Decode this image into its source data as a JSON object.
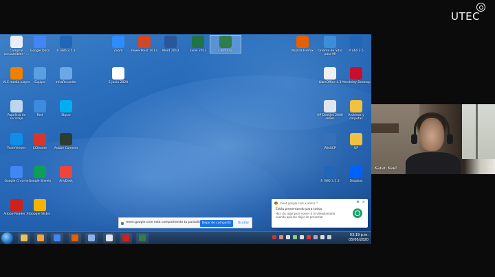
{
  "branding": {
    "logo_text": "UTEC"
  },
  "participant": {
    "name": "Karen Keel"
  },
  "desktop_icons": [
    {
      "label": "Comprar consumibles - ...",
      "icon": "printer-icon",
      "color": "#e9eef5"
    },
    {
      "label": "Google Docs",
      "icon": "docs-icon",
      "color": "#4285f4"
    },
    {
      "label": "R i386 3.5.3",
      "icon": "r-icon",
      "color": "#2266b8"
    },
    {
      "label": "Zoom",
      "icon": "zoom-icon",
      "color": "#2d8cff"
    },
    {
      "label": "PowerPoint 2013",
      "icon": "powerpoint-icon",
      "color": "#d24726"
    },
    {
      "label": "Word 2013",
      "icon": "word-icon",
      "color": "#2b579a"
    },
    {
      "label": "Excel 2013",
      "icon": "excel-icon",
      "color": "#217346"
    },
    {
      "label": "Camtasia",
      "icon": "camtasia-icon",
      "color": "#2f7d4a"
    },
    {
      "label": "Mozilla Firefox",
      "icon": "firefox-icon",
      "color": "#e66000"
    },
    {
      "label": "Oriente de Sitio para Mí",
      "icon": "box-icon",
      "color": "#3a8fd8"
    },
    {
      "label": "R x64 3.5",
      "icon": "r-icon",
      "color": "#2266b8"
    },
    {
      "label": "VLC media player",
      "icon": "vlc-icon",
      "color": "#f08000"
    },
    {
      "label": "Equipo",
      "icon": "computer-icon",
      "color": "#5aa0e0"
    },
    {
      "label": "InfraRecorder",
      "icon": "disc-icon",
      "color": "#6aa8e8"
    },
    {
      "label": "5 junio 2020",
      "icon": "document-icon",
      "color": "#ffffff"
    },
    {
      "label": "LibreOffice 4.3",
      "icon": "libreoffice-icon",
      "color": "#f0f0f0"
    },
    {
      "label": "Mendeley Desktop",
      "icon": "mendeley-icon",
      "color": "#c8102e"
    },
    {
      "label": "Papelera de reciclaje",
      "icon": "recycle-bin-icon",
      "color": "#bcd6ee"
    },
    {
      "label": "Red",
      "icon": "network-icon",
      "color": "#3d8be0"
    },
    {
      "label": "Skype",
      "icon": "skype-icon",
      "color": "#00aff0"
    },
    {
      "label": "HP DeskJet 2600 series",
      "icon": "printer-icon",
      "color": "#e0e6ee"
    },
    {
      "label": "Archivos y carpetas",
      "icon": "folder-icon",
      "color": "#f0c040"
    },
    {
      "label": "TeamViewer",
      "icon": "teamviewer-icon",
      "color": "#0e8ee9"
    },
    {
      "label": "CCleaner",
      "icon": "ccleaner-icon",
      "color": "#d8362a"
    },
    {
      "label": "Adobe Connect",
      "icon": "connect-icon",
      "color": "#2c3e2f"
    },
    {
      "label": "WinSCP",
      "icon": "winscp-icon",
      "color": "#3570b8"
    },
    {
      "label": "UP",
      "icon": "folder-icon",
      "color": "#f0c040"
    },
    {
      "label": "Google Chrome",
      "icon": "chrome-icon",
      "color": "#4285f4"
    },
    {
      "label": "Google Sheets",
      "icon": "sheets-icon",
      "color": "#0f9d58"
    },
    {
      "label": "AnyDesk",
      "icon": "anydesk-icon",
      "color": "#ef443b"
    },
    {
      "label": "R i386 3.5.3",
      "icon": "r-icon",
      "color": "#2266b8"
    },
    {
      "label": "Dropbox",
      "icon": "dropbox-icon",
      "color": "#0061ff"
    },
    {
      "label": "Adobe Reader XI",
      "icon": "pdf-icon",
      "color": "#d0201b"
    },
    {
      "label": "Google Slides",
      "icon": "slides-icon",
      "color": "#f4b400"
    }
  ],
  "share_bar": {
    "message": "meet.google.com está compartiendo tu pantalla.",
    "stop_label": "Dejar de compartir",
    "hide_label": "Ocultar"
  },
  "notification": {
    "source": "meet.google.com • ahora ^",
    "title": "Estás presentando para todos",
    "body": "Haz clic aquí para volver a la videollamada cuando quieras dejar de presentar",
    "close_symbol": "×",
    "settings_symbol": "⚙"
  },
  "taskbar": {
    "apps": [
      {
        "name": "explorer",
        "icon": "folder-icon",
        "color": "#e8c25a"
      },
      {
        "name": "media",
        "icon": "media-player-icon",
        "color": "#f3a33a"
      },
      {
        "name": "chrome",
        "icon": "chrome-icon",
        "color": "#4285f4"
      },
      {
        "name": "firefox",
        "icon": "firefox-icon",
        "color": "#e66000"
      },
      {
        "name": "network",
        "icon": "network-icon",
        "color": "#8ab4e8"
      },
      {
        "name": "notepad",
        "icon": "document-icon",
        "color": "#dfe8f2"
      },
      {
        "name": "pdf",
        "icon": "pdf-icon",
        "color": "#d0201b"
      },
      {
        "name": "camtasia",
        "icon": "camtasia-icon",
        "color": "#2f7d4a"
      }
    ],
    "clock_time": "03:19 p.m.",
    "clock_date": "05/06/2020"
  }
}
